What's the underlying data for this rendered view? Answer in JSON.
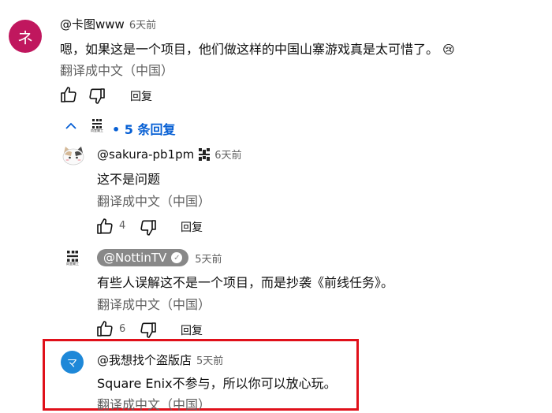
{
  "comment": {
    "avatar_letter": "ネ",
    "avatar_color": "#c0175e",
    "handle": "@卡图www",
    "time": "6天前",
    "text": "嗯，如果这是一个项目，他们做这样的中国山寨游戏真是太可惜了。",
    "emoji": "😢",
    "translate": "翻译成中文（中国）",
    "reply_label": "回复"
  },
  "replies_toggle": {
    "logo_caption": "尚堂爾工",
    "label": "• 5 条回复"
  },
  "replies": [
    {
      "handle": "@sakura-pb1pm",
      "time": "6天前",
      "text": "这不是问题",
      "translate": "翻译成中文（中国）",
      "likes": "4",
      "reply_label": "回复"
    },
    {
      "handle": "@NottinTV",
      "time": "5天前",
      "text": "有些人误解这不是一个项目，而是抄袭《前线任务》。",
      "translate": "翻译成中文（中国）",
      "likes": "6",
      "reply_label": "回复",
      "logo_caption": "尚堂爾工"
    },
    {
      "avatar_letter": "マ",
      "avatar_color": "#1e88d8",
      "handle": "@我想找个盗版店",
      "time": "5天前",
      "text": "Square Enix不参与，所以你可以放心玩。",
      "translate": "翻译成中文（中国）"
    }
  ],
  "colors": {
    "highlight_border": "#e0101a",
    "link_blue": "#065fd4"
  }
}
